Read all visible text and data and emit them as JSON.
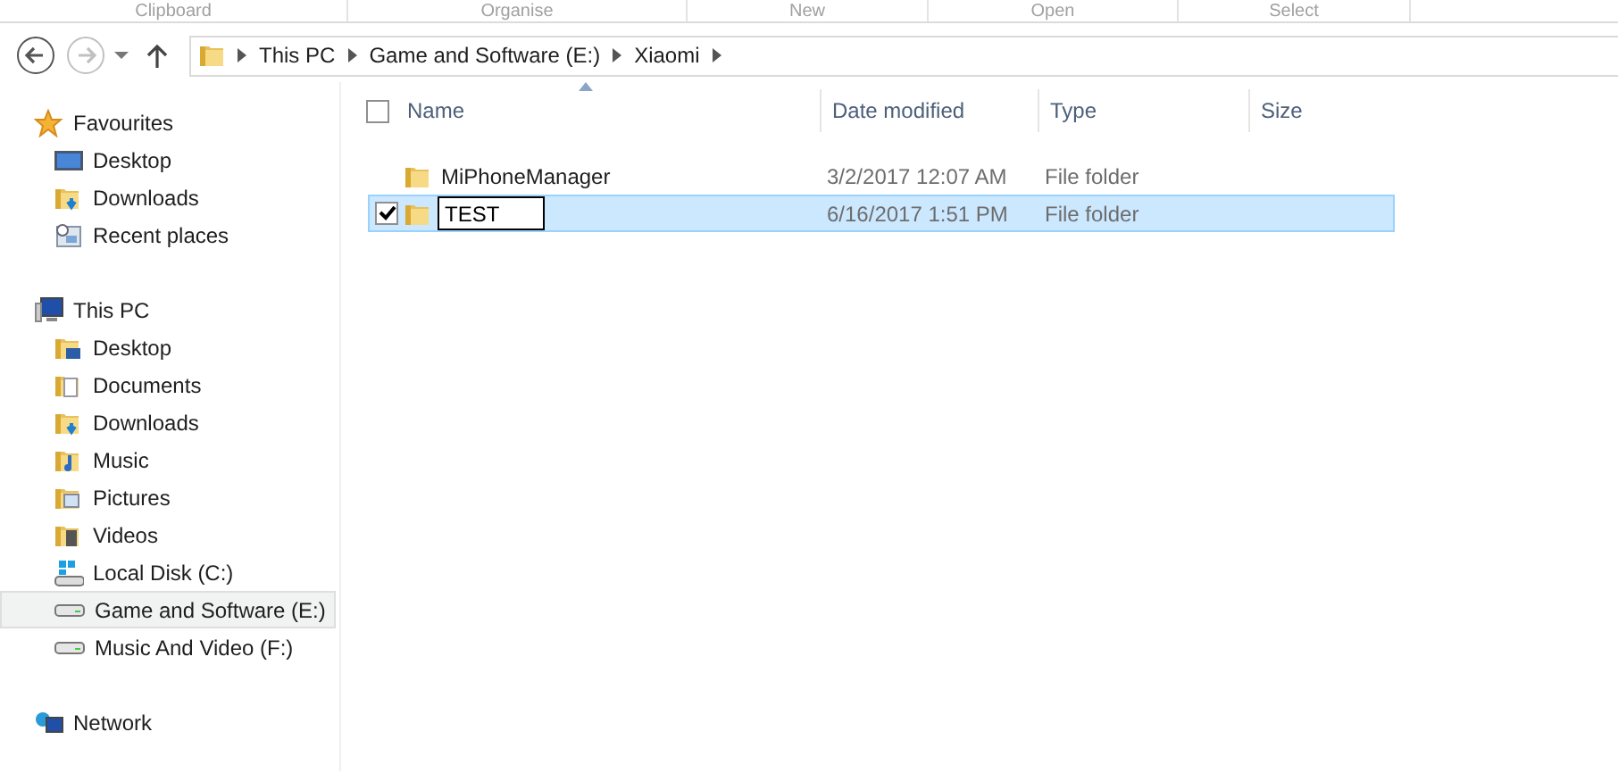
{
  "ribbon_groups": [
    "Clipboard",
    "Organise",
    "New",
    "Open",
    "Select"
  ],
  "navigation": {
    "back_disabled": false,
    "forward_disabled": true
  },
  "breadcrumb": [
    "This PC",
    "Game and Software (E:)",
    "Xiaomi"
  ],
  "sidebar": [
    {
      "label": "Favourites",
      "kind": "star",
      "selected": false,
      "children": [
        {
          "label": "Desktop",
          "kind": "desktop",
          "selected": false
        },
        {
          "label": "Downloads",
          "kind": "downloads",
          "selected": false
        },
        {
          "label": "Recent places",
          "kind": "recent",
          "selected": false
        }
      ]
    },
    {
      "label": "This PC",
      "kind": "pc",
      "selected": false,
      "children": [
        {
          "label": "Desktop",
          "kind": "desktop-folder",
          "selected": false
        },
        {
          "label": "Documents",
          "kind": "documents",
          "selected": false
        },
        {
          "label": "Downloads",
          "kind": "downloads",
          "selected": false
        },
        {
          "label": "Music",
          "kind": "music",
          "selected": false
        },
        {
          "label": "Pictures",
          "kind": "pictures",
          "selected": false
        },
        {
          "label": "Videos",
          "kind": "videos",
          "selected": false
        },
        {
          "label": "Local Disk (C:)",
          "kind": "system-drive",
          "selected": false
        },
        {
          "label": "Game and Software (E:)",
          "kind": "drive",
          "selected": true
        },
        {
          "label": "Music And Video (F:)",
          "kind": "drive",
          "selected": false
        }
      ]
    },
    {
      "label": "Network",
      "kind": "network",
      "selected": false
    }
  ],
  "table": {
    "select_all_checked": false,
    "columns": [
      {
        "label": "Name",
        "sorted": true
      },
      {
        "label": "Date modified",
        "sorted": false
      },
      {
        "label": "Type",
        "sorted": false
      },
      {
        "label": "Size",
        "sorted": false
      }
    ],
    "rows": [
      {
        "name": "MiPhoneManager",
        "date_modified": "3/2/2017 12:07 AM",
        "type": "File folder",
        "selected": false,
        "checked": false,
        "renaming": false
      },
      {
        "name": "TEST",
        "date_modified": "6/16/2017 1:51 PM",
        "type": "File folder",
        "selected": true,
        "checked": true,
        "renaming": true
      }
    ]
  }
}
